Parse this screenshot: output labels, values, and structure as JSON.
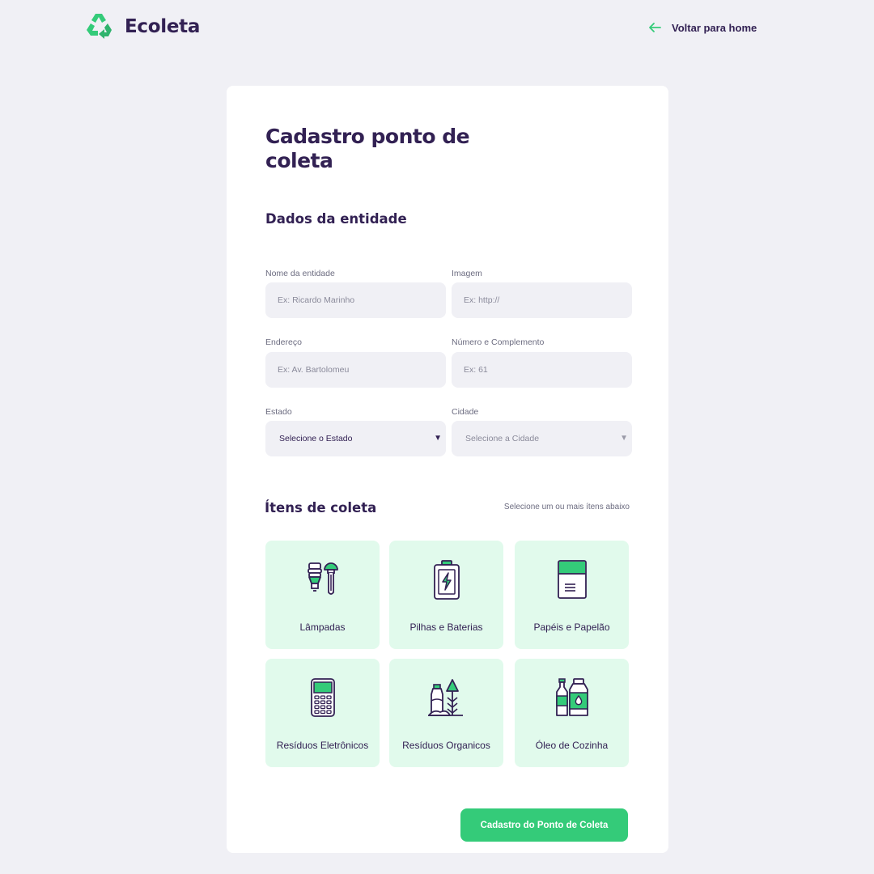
{
  "header": {
    "brand": "Ecoleta",
    "back_label": "Voltar para home"
  },
  "form": {
    "title": "Cadastro ponto de coleta",
    "section_entity": "Dados da entidade",
    "fields": {
      "name": {
        "label": "Nome da entidade",
        "placeholder": "Ex: Ricardo Marinho"
      },
      "image": {
        "label": "Imagem",
        "placeholder": "Ex: http://"
      },
      "address": {
        "label": "Endereço",
        "placeholder": "Ex: Av. Bartolomeu"
      },
      "number": {
        "label": "Número e Complemento",
        "placeholder": "Ex: 61"
      },
      "state": {
        "label": "Estado",
        "value": "Selecione o Estado"
      },
      "city": {
        "label": "Cidade",
        "value": "Selecione a Cidade"
      }
    },
    "section_items": "Ítens de coleta",
    "items_hint": "Selecione um ou mais ítens abaixo",
    "items": [
      {
        "label": "Lâmpadas",
        "icon": "lamp-icon"
      },
      {
        "label": "Pilhas e Baterias",
        "icon": "battery-icon"
      },
      {
        "label": "Papéis e Papelão",
        "icon": "paper-icon"
      },
      {
        "label": "Resíduos Eletrônicos",
        "icon": "electronics-icon"
      },
      {
        "label": "Resíduos Organicos",
        "icon": "organic-icon"
      },
      {
        "label": "Óleo de Cozinha",
        "icon": "oil-icon"
      }
    ],
    "submit_label": "Cadastro do Ponto de Coleta"
  },
  "colors": {
    "accent": "#34cb79",
    "text": "#322153",
    "muted": "#6c6c80",
    "background": "#f0f0f5",
    "item_background": "#e1faec"
  }
}
